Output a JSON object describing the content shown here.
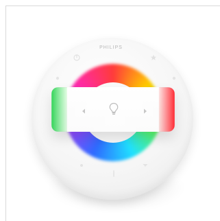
{
  "brand": {
    "text": "PHILIPS"
  },
  "colors": {
    "frame_line": "#d9d9d9",
    "remote_base": "#f6f6f6",
    "panel_base": "#ffffff",
    "left_edge": "#28d250",
    "right_edge": "#ff1e28"
  },
  "icons": {
    "top_left": "power-icon",
    "top_right": "star-icon",
    "mid_left": "circle-dot-icon",
    "mid_right": "circle-dot-icon",
    "center": "lightbulb-icon",
    "left_arrow": "chevron-left-icon",
    "right_arrow": "chevron-right-icon",
    "bottom_left": "dot-icon",
    "bottom_center": "minus-icon",
    "bottom_right": "chevron-down-icon"
  }
}
